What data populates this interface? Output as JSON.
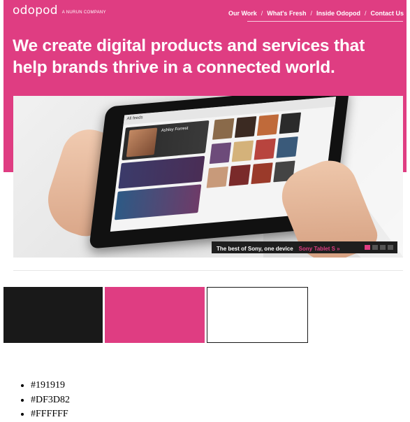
{
  "brand": {
    "logo": "odopod",
    "logo_tagline": "A NURUN COMPANY"
  },
  "nav": {
    "items": [
      "Our Work",
      "What's Fresh",
      "Inside Odopod",
      "Contact Us"
    ],
    "separator": "/"
  },
  "headline": "We create digital products and services that help brands thrive in a connected world.",
  "hero": {
    "device_header": "All feeds",
    "device_feature_name": "Ashley Forrest",
    "caption": "The best of Sony, one device",
    "caption_link": "Sony Tablet S »",
    "slides": [
      true,
      false,
      false,
      false
    ]
  },
  "palette": {
    "swatches": [
      "#191919",
      "#DF3D82",
      "#FFFFFF"
    ],
    "labels": [
      "#191919",
      "#DF3D82",
      "#FFFFFF"
    ]
  }
}
